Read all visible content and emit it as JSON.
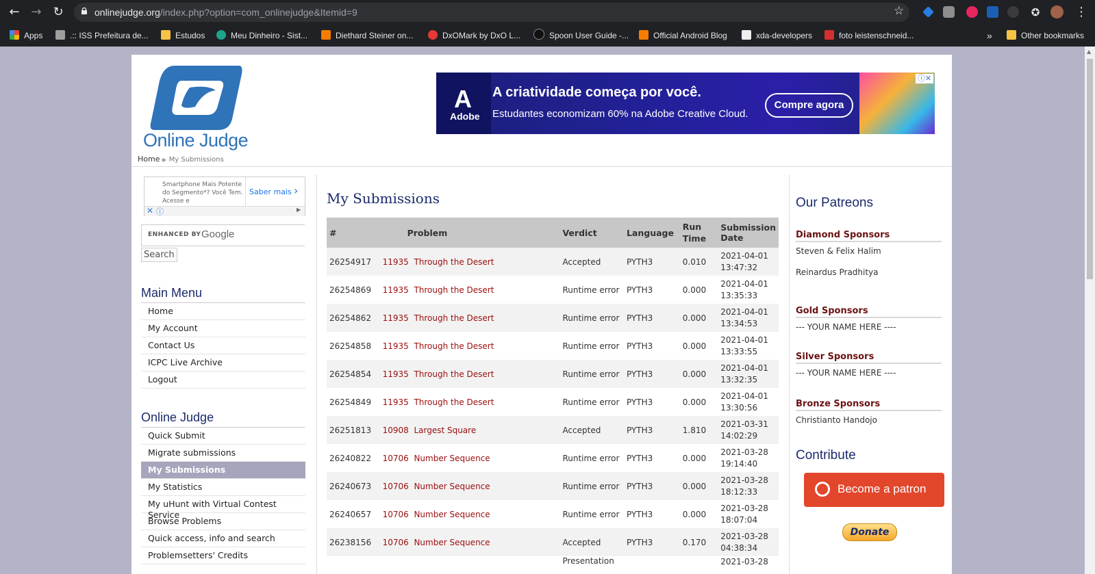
{
  "browser": {
    "url_host": "onlinejudge.org",
    "url_path": "/index.php?option=com_onlinejudge&Itemid=9",
    "bookmarks": [
      {
        "label": "Apps",
        "color": "#ea4335"
      },
      {
        "label": ".:: ISS Prefeitura de...",
        "color": "#9e9e9e"
      },
      {
        "label": "Estudos",
        "color": "#f6c344"
      },
      {
        "label": "Meu Dinheiro - Sist...",
        "color": "#1fa28c"
      },
      {
        "label": "Diethard Steiner on...",
        "color": "#f57c00"
      },
      {
        "label": "DxOMark by DxO L...",
        "color": "#e53935"
      },
      {
        "label": "Spoon User Guide -...",
        "color": "#111111"
      },
      {
        "label": "Official Android Blog",
        "color": "#f57c00"
      },
      {
        "label": "xda-developers",
        "color": "#eeeeee"
      },
      {
        "label": "foto leistenschneid...",
        "color": "#d32f2f"
      }
    ],
    "overflow": "»",
    "other_bookmarks": "Other bookmarks"
  },
  "site": {
    "logo_text": "Online Judge",
    "breadcrumb_home": "Home",
    "breadcrumb_current": "My Submissions"
  },
  "ad_banner": {
    "brand": "Adobe",
    "headline": "A criatividade começa por você.",
    "subline": "Estudantes economizam 60% na Adobe Creative Cloud.",
    "cta": "Compre agora"
  },
  "side_ad": {
    "text": "Smartphone Mais Potente do Segmento*? Você Tem. Acesse e",
    "cta": "Saber mais"
  },
  "search": {
    "enhanced_by": "ENHANCED BY",
    "google": "Google",
    "button": "Search"
  },
  "main_menu": {
    "title": "Main Menu",
    "items": [
      "Home",
      "My Account",
      "Contact Us",
      "ICPC Live Archive",
      "Logout"
    ]
  },
  "oj_menu": {
    "title": "Online Judge",
    "items": [
      "Quick Submit",
      "Migrate submissions",
      "My Submissions",
      "My Statistics",
      "My uHunt with Virtual Contest Service",
      "Browse Problems",
      "Quick access, info and search",
      "Problemsetters' Credits"
    ],
    "active_index": 2
  },
  "submissions": {
    "title": "My Submissions",
    "headers": [
      "#",
      "Problem",
      "Verdict",
      "Language",
      "Run Time",
      "Submission Date"
    ],
    "rows": [
      {
        "id": "26254917",
        "pnum": "11935",
        "pname": "Through the Desert",
        "verdict": "Accepted",
        "lang": "PYTH3",
        "time": "0.010",
        "date": "2021-04-01",
        "clock": "13:47:32"
      },
      {
        "id": "26254869",
        "pnum": "11935",
        "pname": "Through the Desert",
        "verdict": "Runtime error",
        "lang": "PYTH3",
        "time": "0.000",
        "date": "2021-04-01",
        "clock": "13:35:33"
      },
      {
        "id": "26254862",
        "pnum": "11935",
        "pname": "Through the Desert",
        "verdict": "Runtime error",
        "lang": "PYTH3",
        "time": "0.000",
        "date": "2021-04-01",
        "clock": "13:34:53"
      },
      {
        "id": "26254858",
        "pnum": "11935",
        "pname": "Through the Desert",
        "verdict": "Runtime error",
        "lang": "PYTH3",
        "time": "0.000",
        "date": "2021-04-01",
        "clock": "13:33:55"
      },
      {
        "id": "26254854",
        "pnum": "11935",
        "pname": "Through the Desert",
        "verdict": "Runtime error",
        "lang": "PYTH3",
        "time": "0.000",
        "date": "2021-04-01",
        "clock": "13:32:35"
      },
      {
        "id": "26254849",
        "pnum": "11935",
        "pname": "Through the Desert",
        "verdict": "Runtime error",
        "lang": "PYTH3",
        "time": "0.000",
        "date": "2021-04-01",
        "clock": "13:30:56"
      },
      {
        "id": "26251813",
        "pnum": "10908",
        "pname": "Largest Square",
        "verdict": "Accepted",
        "lang": "PYTH3",
        "time": "1.810",
        "date": "2021-03-31",
        "clock": "14:02:29"
      },
      {
        "id": "26240822",
        "pnum": "10706",
        "pname": "Number Sequence",
        "verdict": "Runtime error",
        "lang": "PYTH3",
        "time": "0.000",
        "date": "2021-03-28",
        "clock": "19:14:40"
      },
      {
        "id": "26240673",
        "pnum": "10706",
        "pname": "Number Sequence",
        "verdict": "Runtime error",
        "lang": "PYTH3",
        "time": "0.000",
        "date": "2021-03-28",
        "clock": "18:12:33"
      },
      {
        "id": "26240657",
        "pnum": "10706",
        "pname": "Number Sequence",
        "verdict": "Runtime error",
        "lang": "PYTH3",
        "time": "0.000",
        "date": "2021-03-28",
        "clock": "18:07:04"
      },
      {
        "id": "26238156",
        "pnum": "10706",
        "pname": "Number Sequence",
        "verdict": "Accepted",
        "lang": "PYTH3",
        "time": "0.170",
        "date": "2021-03-28",
        "clock": "04:38:34"
      },
      {
        "id": "",
        "pnum": "",
        "pname": "",
        "verdict": "Presentation",
        "lang": "",
        "time": "",
        "date": "2021-03-28",
        "clock": ""
      }
    ]
  },
  "patreons": {
    "title": "Our Patreons",
    "diamond_title": "Diamond Sponsors",
    "diamond_names": [
      "Steven & Felix Halim",
      "Reinardus Pradhitya"
    ],
    "gold_title": "Gold Sponsors",
    "gold_names": [
      "--- YOUR NAME HERE ----"
    ],
    "silver_title": "Silver Sponsors",
    "silver_names": [
      "--- YOUR NAME HERE ----"
    ],
    "bronze_title": "Bronze Sponsors",
    "bronze_names": [
      "Christianto Handojo"
    ],
    "contribute_title": "Contribute",
    "patron_button": "Become a patron",
    "donate_button": "Donate"
  }
}
